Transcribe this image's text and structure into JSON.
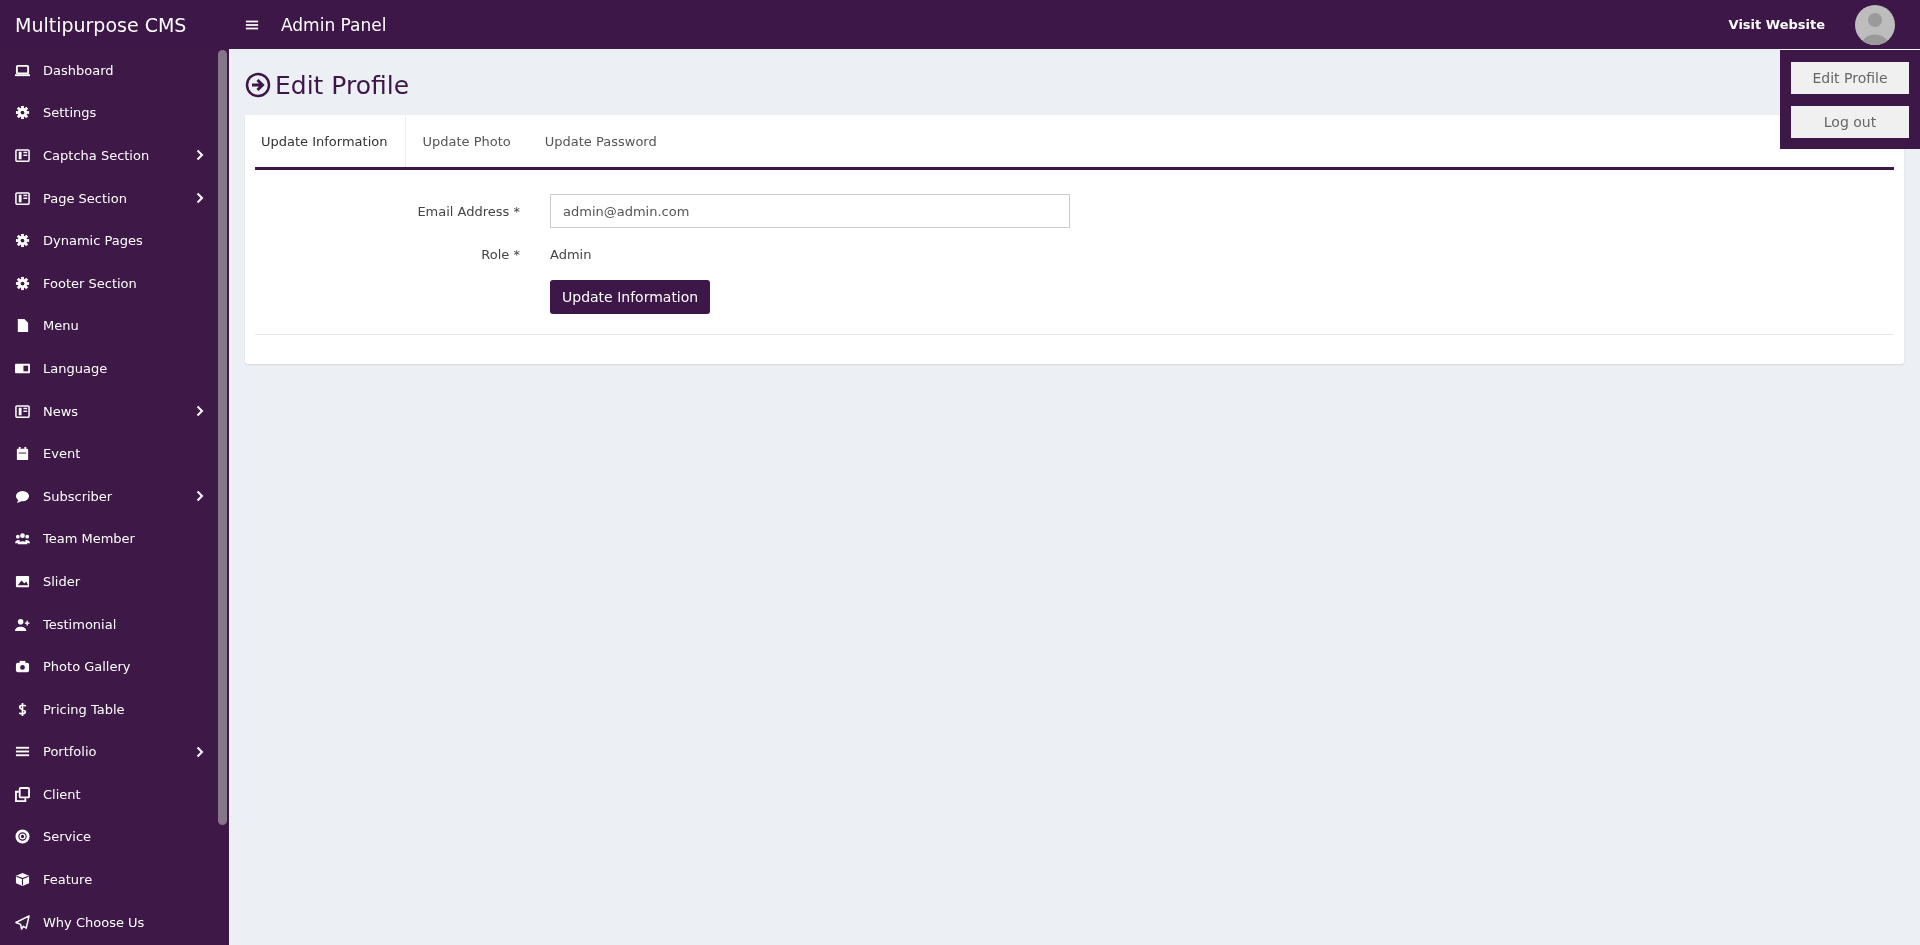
{
  "header": {
    "brand": "Multipurpose CMS",
    "title": "Admin Panel",
    "visit_link": "Visit Website",
    "user_menu": {
      "expanded": true,
      "items": [
        "Edit Profile",
        "Log out"
      ]
    }
  },
  "sidebar": {
    "items": [
      {
        "label": "Dashboard",
        "expandable": false
      },
      {
        "label": "Settings",
        "expandable": false
      },
      {
        "label": "Captcha Section",
        "expandable": true
      },
      {
        "label": "Page Section",
        "expandable": true
      },
      {
        "label": "Dynamic Pages",
        "expandable": false
      },
      {
        "label": "Footer Section",
        "expandable": false
      },
      {
        "label": "Menu",
        "expandable": false
      },
      {
        "label": "Language",
        "expandable": false
      },
      {
        "label": "News",
        "expandable": true
      },
      {
        "label": "Event",
        "expandable": false
      },
      {
        "label": "Subscriber",
        "expandable": true
      },
      {
        "label": "Team Member",
        "expandable": false
      },
      {
        "label": "Slider",
        "expandable": false
      },
      {
        "label": "Testimonial",
        "expandable": false
      },
      {
        "label": "Photo Gallery",
        "expandable": false
      },
      {
        "label": "Pricing Table",
        "expandable": false
      },
      {
        "label": "Portfolio",
        "expandable": true
      },
      {
        "label": "Client",
        "expandable": false
      },
      {
        "label": "Service",
        "expandable": false
      },
      {
        "label": "Feature",
        "expandable": false
      },
      {
        "label": "Why Choose Us",
        "expandable": false
      }
    ]
  },
  "page": {
    "title": "Edit Profile",
    "tabs": [
      {
        "label": "Update Information",
        "selected": true
      },
      {
        "label": "Update Photo",
        "selected": false
      },
      {
        "label": "Update Password",
        "selected": false
      }
    ],
    "form": {
      "fields": [
        {
          "kind": "input",
          "label": "Email Address *",
          "value": "admin@admin.com"
        },
        {
          "kind": "text",
          "label": "Role *",
          "value": "Admin"
        }
      ],
      "submit": "Update Information"
    }
  }
}
